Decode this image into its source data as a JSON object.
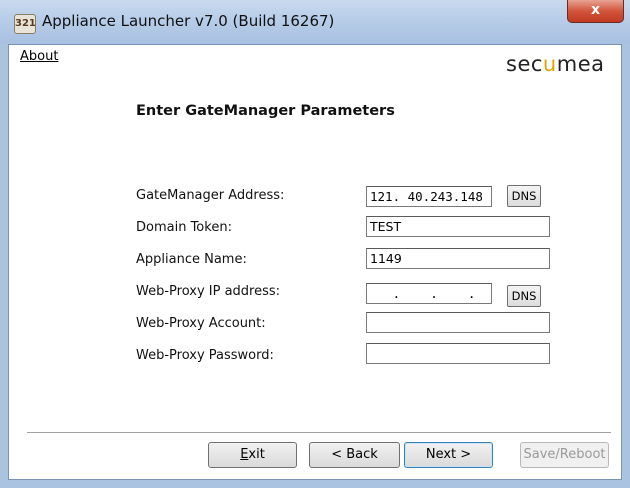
{
  "window": {
    "icon_text": "321",
    "title": "Appliance Launcher v7.0 (Build 16267)",
    "close_glyph": "x"
  },
  "menu": {
    "about": "About"
  },
  "brand": {
    "logo_pre": "sec",
    "logo_u": "u",
    "logo_post": "mea",
    "accent": "#e2a400"
  },
  "form": {
    "heading": "Enter GateManager Parameters",
    "gatemanager_address": {
      "label": "GateManager Address:",
      "value": "121. 40.243.148"
    },
    "domain_token": {
      "label": "Domain Token:",
      "value": "TEST"
    },
    "appliance_name": {
      "label": "Appliance Name:",
      "value": "1149"
    },
    "proxy_ip": {
      "label": "Web-Proxy IP address:",
      "value": "   .    .    ."
    },
    "proxy_account": {
      "label": "Web-Proxy Account:",
      "value": ""
    },
    "proxy_password": {
      "label": "Web-Proxy Password:",
      "value": ""
    },
    "dns_label": "DNS"
  },
  "buttons": {
    "exit": "Exit",
    "back": "< Back",
    "next": "Next >",
    "save_reboot": "Save/Reboot"
  }
}
